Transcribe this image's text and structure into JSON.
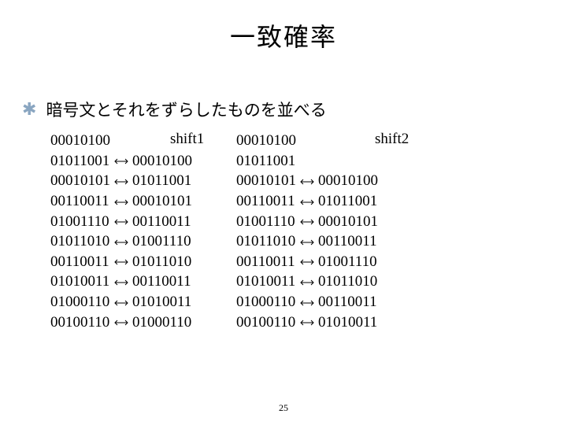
{
  "title": "一致確率",
  "bullet_text": "暗号文とそれをずらしたものを並べる",
  "page_number": "25",
  "shift1_label": "shift1",
  "shift2_label": "shift2",
  "block1": {
    "left": [
      "00010100",
      "01011001",
      "00010101",
      "00110011",
      "01001110",
      "01011010",
      "00110011",
      "01010011",
      "01000110",
      "00100110"
    ],
    "right": [
      "",
      "00010100",
      "01011001",
      "00010101",
      "00110011",
      "01001110",
      "01011010",
      "00110011",
      "01010011",
      "01000110"
    ]
  },
  "block2": {
    "left": [
      "00010100",
      "01011001",
      "00010101",
      "00110011",
      "01001110",
      "01011010",
      "00110011",
      "01010011",
      "01000110",
      "00100110"
    ],
    "right": [
      "",
      "",
      "00010100",
      "01011001",
      "00010101",
      "00110011",
      "01001110",
      "01011010",
      "00110011",
      "01010011"
    ]
  }
}
